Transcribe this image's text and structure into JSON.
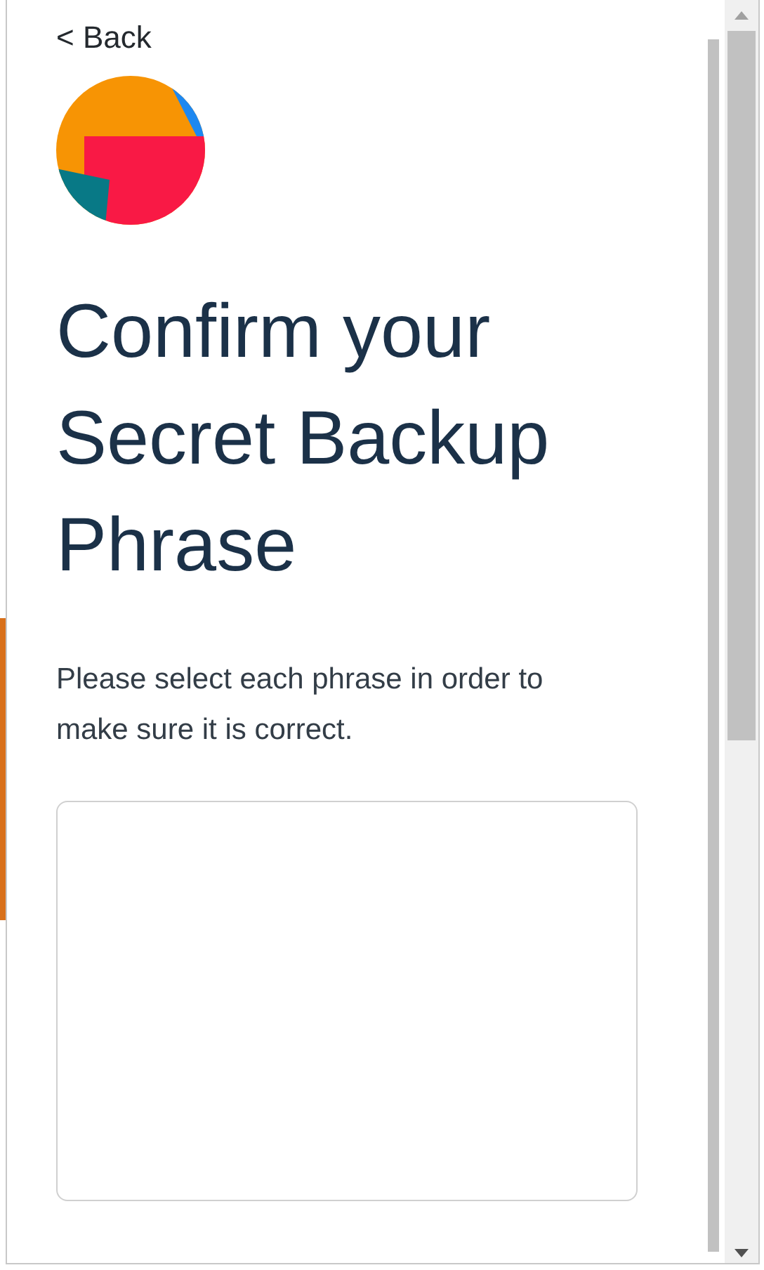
{
  "back_link": "< Back",
  "title": "Confirm your Secret Backup Phrase",
  "instructions": "Please select each phrase in order to make sure it is correct."
}
